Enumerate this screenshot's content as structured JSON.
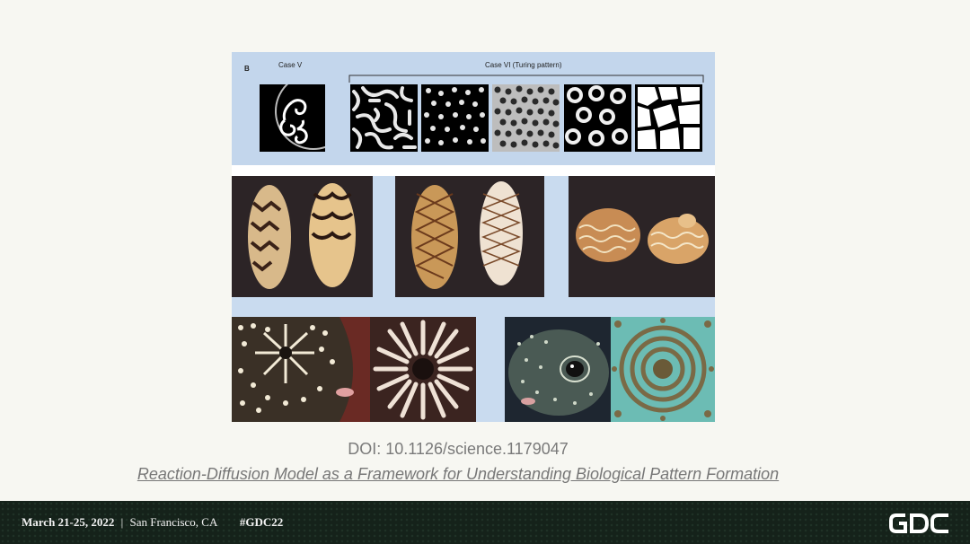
{
  "figure": {
    "panel_label": "B",
    "case5_label": "Case V",
    "case6_label": "Case VI (Turing pattern)"
  },
  "citation": {
    "doi": "DOI: 10.1126/science.1179047",
    "title": "Reaction-Diffusion Model as a Framework for Understanding Biological Pattern Formation"
  },
  "footer": {
    "dates": "March 21-25, 2022",
    "separator": "|",
    "location": "San Francisco, CA",
    "hashtag": "#GDC22",
    "logo_text": "GDC"
  },
  "colors": {
    "footer_bg": "#15221a",
    "figure_bg": "#c3d6ec",
    "slide_bg": "#f7f7f2"
  }
}
